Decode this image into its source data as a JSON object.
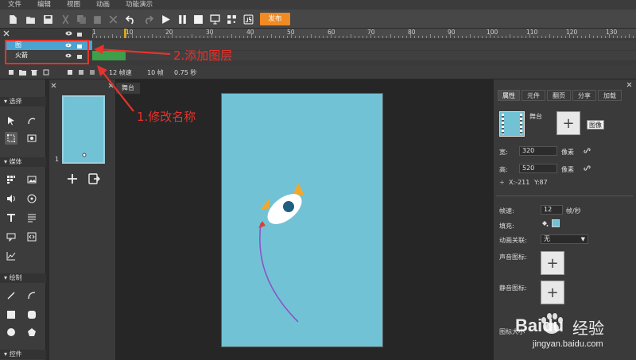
{
  "menu": [
    "文件",
    "编辑",
    "视图",
    "动画",
    "功能演示"
  ],
  "toolbar": {
    "publish_label": "发布"
  },
  "timeline": {
    "ruler_ticks": [
      "1",
      "10",
      "20",
      "30",
      "40",
      "50",
      "60",
      "70",
      "80",
      "90",
      "100",
      "110",
      "120",
      "130"
    ],
    "layers": [
      {
        "name": "图"
      },
      {
        "name": "火箭"
      }
    ],
    "status": {
      "fps": "12 帧速",
      "frame": "10 帧",
      "time": "0.75 秒"
    }
  },
  "annotations": {
    "step1": "1.修改名称",
    "step2": "2.添加图层"
  },
  "left_tools": {
    "section_select": "选择",
    "section_media": "媒体",
    "section_draw": "绘制",
    "section_control": "控件"
  },
  "scene_panel": {
    "thumb_index": "1"
  },
  "stage": {
    "tab_label": "舞台"
  },
  "props": {
    "tabs": [
      "属性",
      "元件",
      "翻页",
      "分享",
      "加载"
    ],
    "stage_label": "舞台",
    "image_button": "图像",
    "width_label": "宽:",
    "width_value": "320",
    "height_label": "高:",
    "height_value": "520",
    "unit": "像素",
    "x_label": "X:-211",
    "y_label": "Y:87",
    "fps_label": "帧速:",
    "fps_value": "12",
    "fps_unit": "帧/秒",
    "fill_label": "填充:",
    "anim_link_label": "动画关联:",
    "anim_link_value": "无",
    "sound_icon_label": "声音图标:",
    "mute_icon_label": "静音图标:",
    "icon_size_label": "图标大小"
  },
  "watermark": {
    "brand": "Baidu",
    "cn": "经验",
    "url": "jingyan.baidu.com"
  },
  "colors": {
    "accent": "#f08a22",
    "selected_layer": "#4aa3d0",
    "keyframes": "#3f9e4a",
    "stage_bg": "#72c2d5",
    "annotation": "#e8322c"
  }
}
